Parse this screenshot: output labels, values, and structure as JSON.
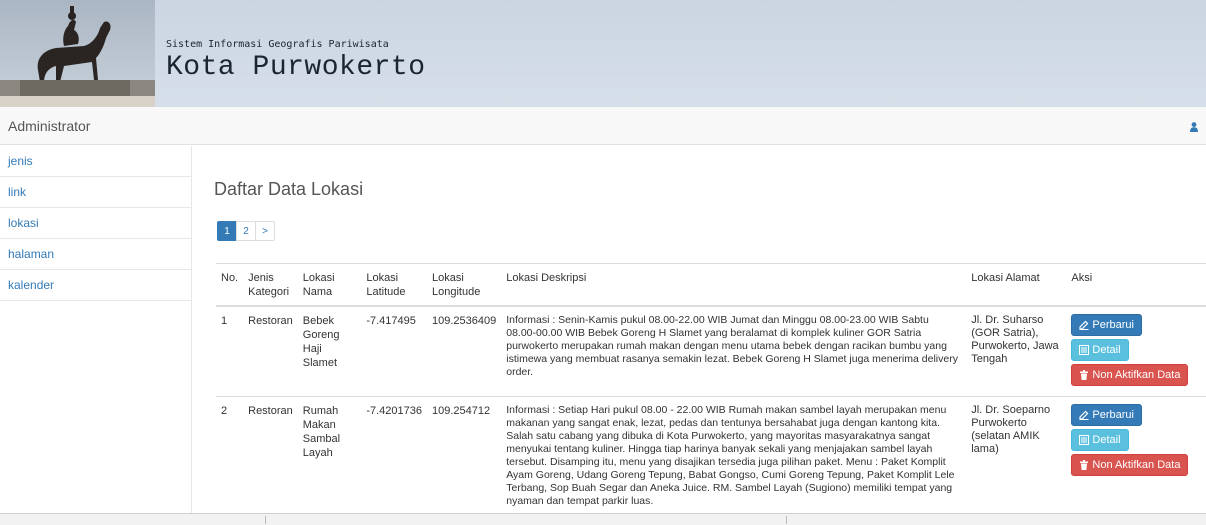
{
  "banner": {
    "subtitle": "Sistem Informasi Geografis Pariwisata",
    "title": "Kota Purwokerto"
  },
  "navbar": {
    "brand": "Administrator",
    "user_icon": "user-icon"
  },
  "sidebar": {
    "items": [
      {
        "label": "jenis"
      },
      {
        "label": "link"
      },
      {
        "label": "lokasi"
      },
      {
        "label": "halaman"
      },
      {
        "label": "kalender"
      }
    ]
  },
  "main": {
    "title": "Daftar Data Lokasi",
    "pagination": [
      "1",
      "2",
      ">"
    ],
    "table": {
      "headers": {
        "no": "No.",
        "jenis": "Jenis Kategori",
        "nama": "Lokasi Nama",
        "lat": "Lokasi Latitude",
        "lng": "Lokasi Longitude",
        "desk": "Lokasi Deskripsi",
        "alamat": "Lokasi Alamat",
        "aksi": "Aksi"
      },
      "rows": [
        {
          "no": "1",
          "jenis": "Restoran",
          "nama": "Bebek Goreng Haji Slamet",
          "lat": "-7.417495",
          "lng": "109.2536409",
          "desk": "Informasi : Senin-Kamis pukul 08.00-22.00 WIB Jumat dan Minggu 08.00-23.00 WIB Sabtu 08.00-00.00 WIB Bebek Goreng H Slamet yang beralamat di komplek kuliner GOR Satria purwokerto merupakan rumah makan dengan menu utama bebek dengan racikan bumbu yang istimewa yang membuat rasanya semakin lezat. Bebek Goreng H Slamet juga menerima delivery order.",
          "alamat": "Jl. Dr. Suharso (GOR Satria), Purwokerto, Jawa Tengah"
        },
        {
          "no": "2",
          "jenis": "Restoran",
          "nama": "Rumah Makan Sambal Layah",
          "lat": "-7.4201736",
          "lng": "109.254712",
          "desk": "Informasi : Setiap Hari pukul 08.00 - 22.00 WIB Rumah makan sambel layah merupakan menu makanan yang sangat enak, lezat, pedas dan tentunya bersahabat juga dengan kantong kita. Salah satu cabang yang dibuka di Kota Purwokerto, yang mayoritas masyarakatnya sangat menyukai tentang kuliner. Hingga tiap harinya banyak sekali yang menjajakan sambel layah tersebut. Disamping itu, menu yang disajikan tersedia juga pilihan paket. Menu : Paket Komplit Ayam Goreng, Udang Goreng Tepung, Babat Gongso, Cumi Goreng Tepung, Paket Komplit Lele Terbang, Sop Buah Segar dan Aneka Juice. RM. Sambel Layah (Sugiono) memiliki tempat yang nyaman dan tempat parkir luas.",
          "alamat": "Jl. Dr. Soeparno Purwokerto (selatan AMIK lama)"
        }
      ]
    },
    "actions": {
      "update": "Perbarui",
      "detail": "Detail",
      "deactivate": "Non Aktifkan Data"
    }
  },
  "colors": {
    "primary": "#337ab7",
    "info": "#5bc0de",
    "danger": "#d9534f",
    "banner": "#cad5e1"
  }
}
